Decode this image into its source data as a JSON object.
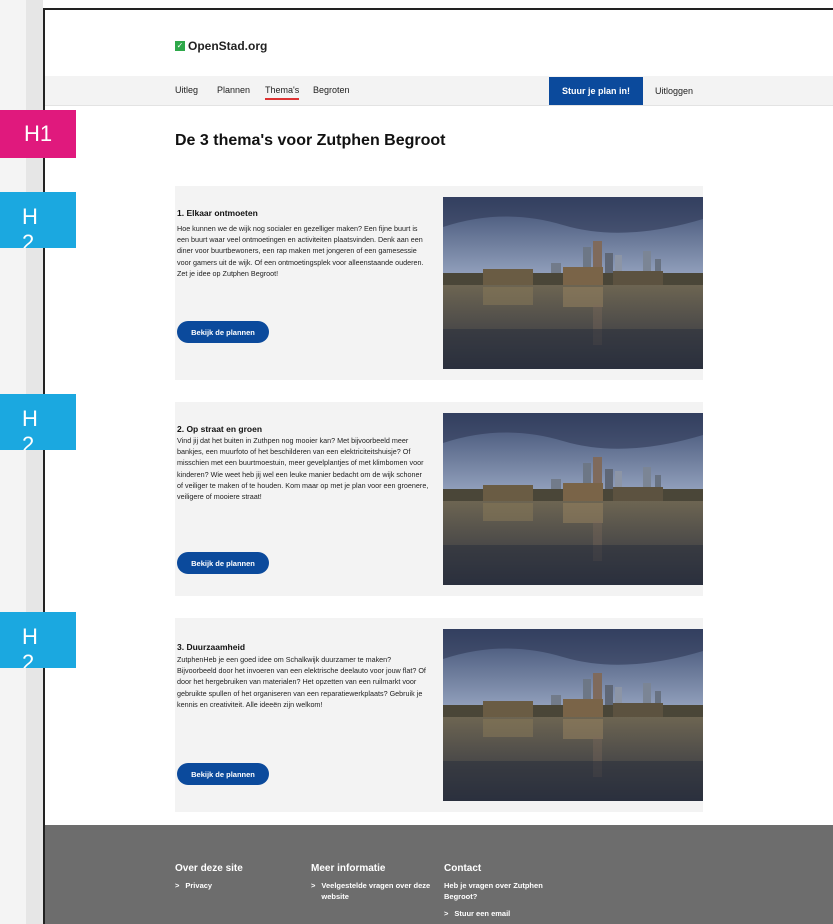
{
  "annotations": {
    "h1_label": "H1",
    "h2_label": "H",
    "h2_sub": "2"
  },
  "logo": {
    "text": "OpenStad.org",
    "icon": "check-square-icon"
  },
  "nav": {
    "items": [
      {
        "label": "Uitleg"
      },
      {
        "label": "Plannen"
      },
      {
        "label": "Thema's"
      },
      {
        "label": "Begroten"
      }
    ],
    "active_index": 2,
    "cta_label": "Stuur je plan in!",
    "logout_label": "Uitloggen"
  },
  "page": {
    "title": "De 3 thema's voor Zutphen Begroot"
  },
  "themes": [
    {
      "title": "1. Elkaar ontmoeten",
      "text": "Hoe kunnen we de wijk nog socialer en gezelliger maken? Een fijne buurt is een buurt waar veel ontmoetingen en activiteiten plaatsvinden. Denk aan een diner voor buurtbewoners, een rap maken met jongeren of een gamesessie voor gamers uit de wijk. Of een ontmoetingsplek voor alleenstaande ouderen. Zet je idee op Zutphen Begroot!",
      "button": "Bekijk de plannen"
    },
    {
      "title": "2. Op straat en groen",
      "text": "Vind jij dat het buiten in Zuthpen nog mooier kan? Met bijvoorbeeld meer bankjes, een muurfoto of het beschilderen van een elektriciteitshuisje? Of misschien met een buurtmoestuin, meer gevelplantjes of met klimbomen voor kinderen? Wie weet heb jij wel een leuke manier bedacht om de wijk schoner of veiliger te maken of te houden. Kom maar op met je plan voor een groenere, veiligere of mooiere straat!",
      "button": "Bekijk de plannen"
    },
    {
      "title": "3. Duurzaamheid",
      "text": "ZutphenHeb je een goed idee om Schalkwijk duurzamer te maken? Bijvoorbeeld door het invoeren van een elektrische deelauto voor jouw flat? Of door het hergebruiken van materialen? Het opzetten van een ruilmarkt voor gebruikte spullen of het organiseren van een reparatiewerkplaats? Gebruik je kennis en creativiteit. Alle ideeën zijn welkom!",
      "button": "Bekijk de plannen"
    }
  ],
  "footer": {
    "col1": {
      "title": "Over deze site",
      "links": [
        "Privacy"
      ]
    },
    "col2": {
      "title": "Meer informatie",
      "links": [
        "Veelgestelde vragen over deze website"
      ]
    },
    "col3": {
      "title": "Contact",
      "text": "Heb je vragen over Zutphen Begroot?",
      "links": [
        "Stuur een email"
      ]
    }
  },
  "colors": {
    "primary": "#0b4a9c",
    "accent_red": "#d33333",
    "h1_badge": "#e0197d",
    "h2_badge": "#1ba8e0",
    "footer_bg": "#6d6d6d",
    "card_bg": "#f3f3f3"
  }
}
